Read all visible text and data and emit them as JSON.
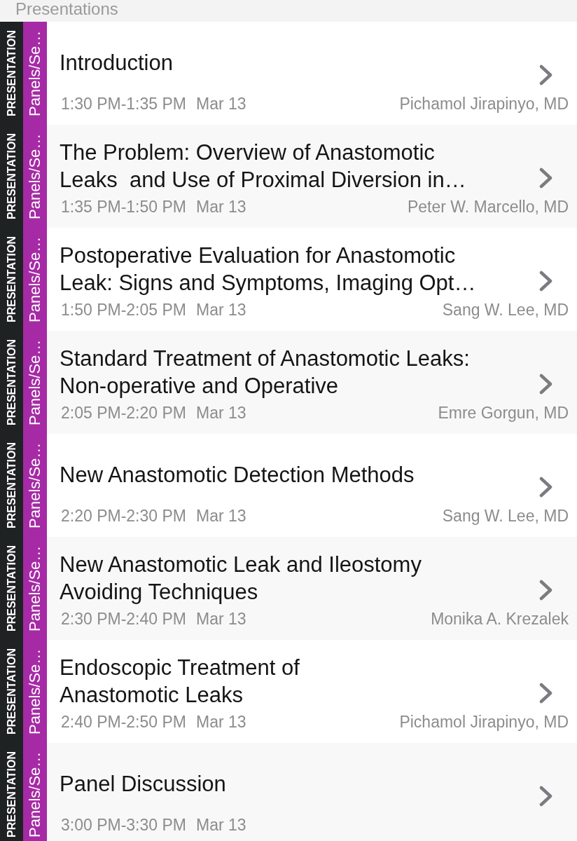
{
  "header": {
    "title": "Presentations"
  },
  "sessions": [
    {
      "type": "PRESENTATION",
      "category": "Panels/Se…",
      "title": "Introduction",
      "time": "1:30 PM-1:35 PM",
      "date": "Mar 13",
      "speaker": "Pichamol Jirapinyo, MD"
    },
    {
      "type": "PRESENTATION",
      "category": "Panels/Se…",
      "title": "The Problem: Overview of Anastomotic\nLeaks  and Use of Proximal Diversion in…",
      "time": "1:35 PM-1:50 PM",
      "date": "Mar 13",
      "speaker": "Peter W. Marcello, MD"
    },
    {
      "type": "PRESENTATION",
      "category": "Panels/Se…",
      "title": "Postoperative Evaluation for Anastomotic\nLeak: Signs and Symptoms, Imaging Opt…",
      "time": "1:50 PM-2:05 PM",
      "date": "Mar 13",
      "speaker": "Sang W. Lee, MD"
    },
    {
      "type": "PRESENTATION",
      "category": "Panels/Se…",
      "title": "Standard Treatment of Anastomotic Leaks:\nNon-operative and Operative",
      "time": "2:05 PM-2:20 PM",
      "date": "Mar 13",
      "speaker": "Emre Gorgun, MD"
    },
    {
      "type": "PRESENTATION",
      "category": "Panels/Se…",
      "title": "New Anastomotic Detection Methods",
      "time": "2:20 PM-2:30 PM",
      "date": "Mar 13",
      "speaker": "Sang W. Lee, MD"
    },
    {
      "type": "PRESENTATION",
      "category": "Panels/Se…",
      "title": "New Anastomotic Leak and Ileostomy\nAvoiding Techniques",
      "time": "2:30 PM-2:40 PM",
      "date": "Mar 13",
      "speaker": "Monika A. Krezalek"
    },
    {
      "type": "PRESENTATION",
      "category": "Panels/Se…",
      "title": "Endoscopic Treatment of\nAnastomotic Leaks",
      "time": "2:40 PM-2:50 PM",
      "date": "Mar 13",
      "speaker": "Pichamol Jirapinyo, MD"
    },
    {
      "type": "PRESENTATION",
      "category": "Panels/Se…",
      "title": "Panel Discussion",
      "time": "3:00 PM-3:30 PM",
      "date": "Mar 13"
    }
  ]
}
